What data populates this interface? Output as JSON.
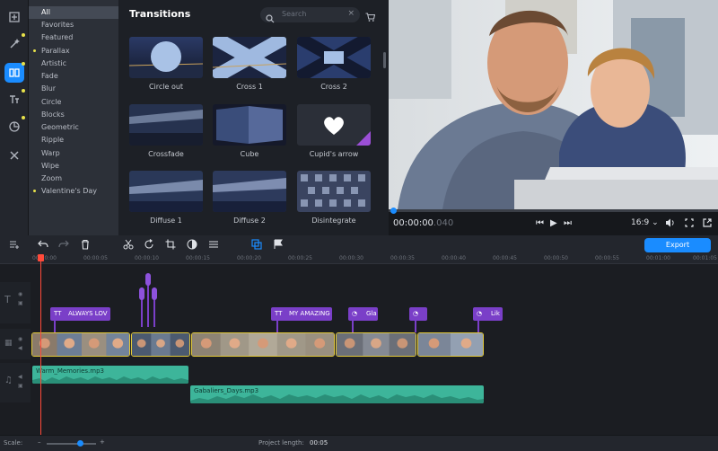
{
  "colors": {
    "accent": "#1a8cff",
    "title_clip": "#7a3fc8",
    "audio_clip": "#3db59a",
    "playhead": "#ff4a3a"
  },
  "tools": [
    "import-icon",
    "magic-wand-icon",
    "transitions-icon",
    "titles-icon",
    "stickers-icon",
    "tools-icon"
  ],
  "categories": [
    "All",
    "Favorites",
    "Featured",
    "Parallax",
    "Artistic",
    "Fade",
    "Blur",
    "Circle",
    "Blocks",
    "Geometric",
    "Ripple",
    "Warp",
    "Wipe",
    "Zoom",
    "Valentine's Day"
  ],
  "panel": {
    "title": "Transitions",
    "search_placeholder": "Search",
    "clear": "×"
  },
  "transitions": [
    "Circle out",
    "Cross 1",
    "Cross 2",
    "Crossfade",
    "Cube",
    "Cupid's arrow",
    "Diffuse 1",
    "Diffuse 2",
    "Disintegrate"
  ],
  "player": {
    "time_main": "00:00:00",
    "time_ms": ".040",
    "aspect": "16:9 ⌄"
  },
  "timeline": {
    "export_label": "Export",
    "ruler": [
      "00:00:00",
      "00:00:05",
      "00:00:10",
      "00:00:15",
      "00:00:20",
      "00:00:25",
      "00:00:30",
      "00:00:35",
      "00:00:40",
      "00:00:45",
      "00:00:50",
      "00:00:55",
      "00:01:00",
      "00:01:05"
    ],
    "title_clips": [
      "ALWAYS LOV",
      "MY AMAZING",
      "Gla",
      "",
      "Lik"
    ],
    "title_glyphs": [
      "TT",
      "TT",
      "◔",
      "◔",
      "◔"
    ],
    "audio_clips": [
      "Warm_Memories.mp3",
      "Gabaliers_Days.mp3"
    ]
  },
  "footer": {
    "scale_label": "Scale:",
    "project_length_label": "Project length:",
    "project_length": "00:05"
  }
}
